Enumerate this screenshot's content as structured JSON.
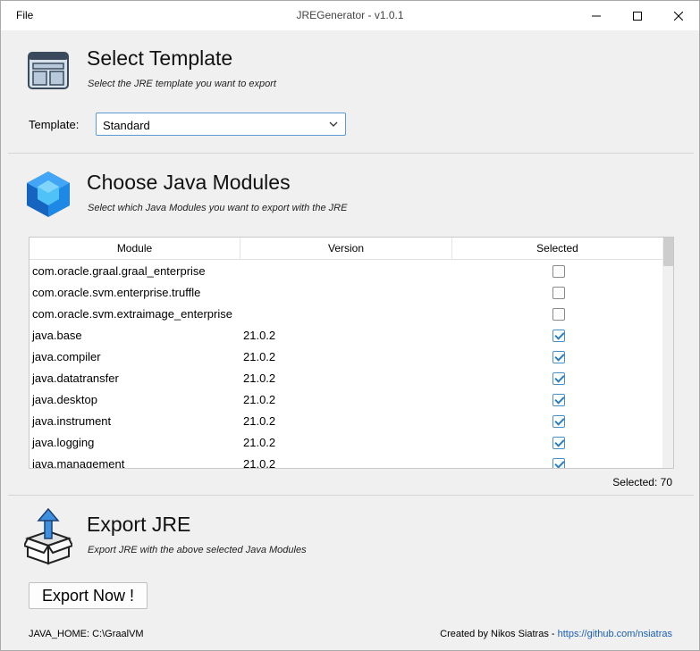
{
  "window": {
    "title": "JREGenerator - v1.0.1",
    "menu_file": "File"
  },
  "template_section": {
    "title": "Select Template",
    "subtitle": "Select the JRE template you want to export",
    "label": "Template:",
    "selected": "Standard"
  },
  "modules_section": {
    "title": "Choose Java Modules",
    "subtitle": "Select which Java Modules you want to export with the JRE",
    "columns": [
      "Module",
      "Version",
      "Selected"
    ],
    "rows": [
      {
        "module": "com.oracle.graal.graal_enterprise",
        "version": "",
        "selected": false
      },
      {
        "module": "com.oracle.svm.enterprise.truffle",
        "version": "",
        "selected": false
      },
      {
        "module": "com.oracle.svm.extraimage_enterprise",
        "version": "",
        "selected": false
      },
      {
        "module": "java.base",
        "version": "21.0.2",
        "selected": true
      },
      {
        "module": "java.compiler",
        "version": "21.0.2",
        "selected": true
      },
      {
        "module": "java.datatransfer",
        "version": "21.0.2",
        "selected": true
      },
      {
        "module": "java.desktop",
        "version": "21.0.2",
        "selected": true
      },
      {
        "module": "java.instrument",
        "version": "21.0.2",
        "selected": true
      },
      {
        "module": "java.logging",
        "version": "21.0.2",
        "selected": true
      },
      {
        "module": "java.management",
        "version": "21.0.2",
        "selected": true
      }
    ],
    "selected_count": "Selected: 70"
  },
  "export_section": {
    "title": "Export JRE",
    "subtitle": "Export JRE with the above selected Java Modules",
    "button": "Export Now !"
  },
  "footer": {
    "java_home": "JAVA_HOME: C:\\GraalVM",
    "credit": "Created by Nikos Siatras - ",
    "link": "https://github.com/nsiatras"
  },
  "colors": {
    "accent": "#2d7fc1",
    "link": "#1a5fb4",
    "cube": "#1e88e5"
  }
}
